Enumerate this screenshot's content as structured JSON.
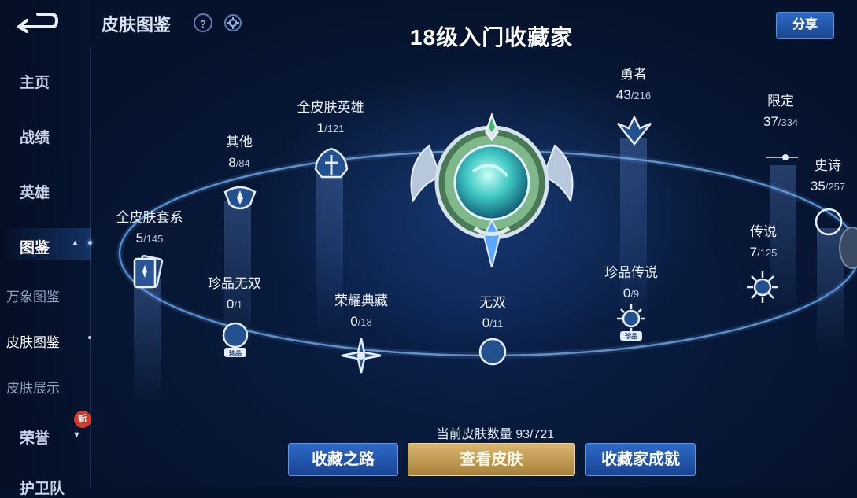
{
  "header": {
    "page_title": "皮肤图鉴",
    "help_icon": "?",
    "main_title": "18级入门收藏家",
    "share_label": "分享"
  },
  "sidebar": {
    "items": [
      {
        "label": "主页"
      },
      {
        "label": "战绩"
      },
      {
        "label": "英雄"
      },
      {
        "label": "图鉴"
      }
    ],
    "subitems": [
      {
        "label": "万象图鉴"
      },
      {
        "label": "皮肤图鉴"
      },
      {
        "label": "皮肤展示"
      }
    ],
    "honor_label": "荣誉",
    "new_badge": "新",
    "partial_label": "护卫队"
  },
  "categories": [
    {
      "name": "全皮肤套系",
      "owned": "5",
      "total": "/145"
    },
    {
      "name": "其他",
      "owned": "8",
      "total": "/84"
    },
    {
      "name": "全皮肤英雄",
      "owned": "1",
      "total": "/121"
    },
    {
      "name": "勇者",
      "owned": "43",
      "total": "/216"
    },
    {
      "name": "限定",
      "owned": "37",
      "total": "/334"
    },
    {
      "name": "史诗",
      "owned": "35",
      "total": "/257"
    },
    {
      "name": "传说",
      "owned": "7",
      "total": "/125"
    },
    {
      "name": "珍品传说",
      "owned": "0",
      "total": "/9"
    },
    {
      "name": "无双",
      "owned": "0",
      "total": "/11"
    },
    {
      "name": "荣耀典藏",
      "owned": "0",
      "total": "/18"
    },
    {
      "name": "珍品无双",
      "owned": "0",
      "total": "/1"
    }
  ],
  "rare_tag": "珍品",
  "bottom": {
    "skin_count": "当前皮肤数量 93/721",
    "btn_path": "收藏之路",
    "btn_view": "查看皮肤",
    "btn_achieve": "收藏家成就"
  },
  "colors": {
    "accent_blue": "#2d69c8",
    "accent_gold": "#d9b56e",
    "background": "#081a3b"
  }
}
